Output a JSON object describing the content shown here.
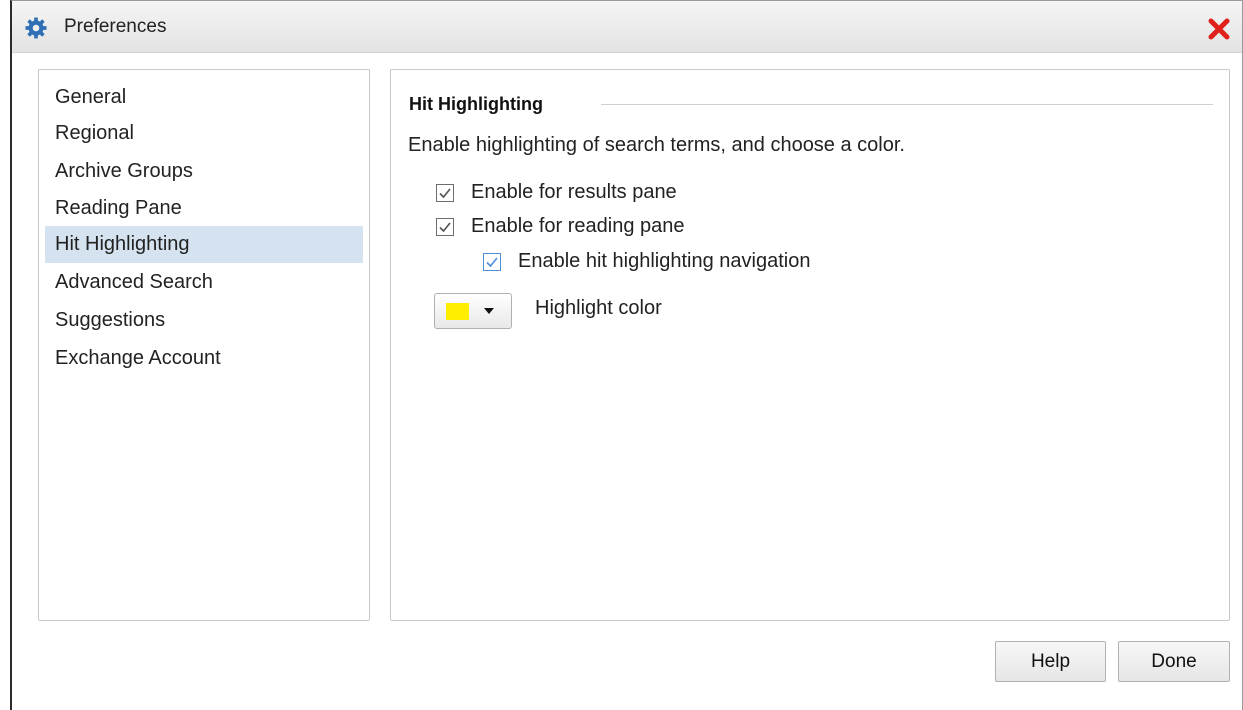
{
  "window": {
    "title": "Preferences",
    "icon": "gear-icon",
    "close_icon": "close-icon"
  },
  "sidebar": {
    "items": [
      {
        "label": "General",
        "selected": false
      },
      {
        "label": "Regional",
        "selected": false
      },
      {
        "label": "Archive Groups",
        "selected": false
      },
      {
        "label": "Reading Pane",
        "selected": false
      },
      {
        "label": "Hit Highlighting",
        "selected": true
      },
      {
        "label": "Advanced Search",
        "selected": false
      },
      {
        "label": "Suggestions",
        "selected": false
      },
      {
        "label": "Exchange Account",
        "selected": false
      }
    ]
  },
  "content": {
    "section_title": "Hit Highlighting",
    "description": "Enable highlighting of search terms, and choose a color.",
    "options": [
      {
        "label": "Enable for results pane",
        "checked": true
      },
      {
        "label": "Enable for reading pane",
        "checked": true
      },
      {
        "label": "Enable hit highlighting navigation",
        "checked": true
      }
    ],
    "highlight_color_label": "Highlight color",
    "highlight_color_value": "#FFEE00"
  },
  "footer": {
    "help_label": "Help",
    "done_label": "Done"
  },
  "colors": {
    "selection_bg": "#D4E3EF",
    "close_red": "#E0201A",
    "gear_blue": "#2F6FB3",
    "check_blue": "#4F8FD6"
  }
}
